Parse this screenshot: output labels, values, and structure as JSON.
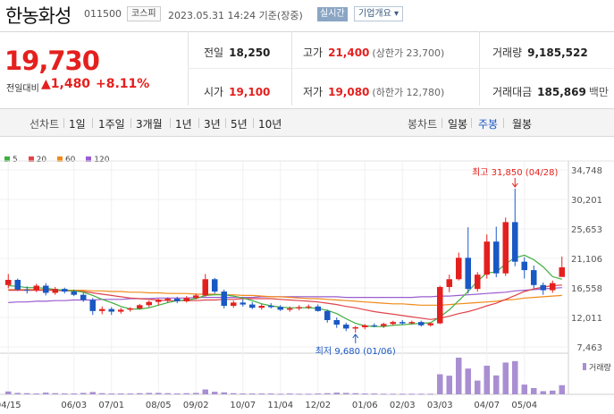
{
  "header": {
    "name": "한농화성",
    "code": "011500",
    "market": "코스피",
    "time": "2023.05.31 14:24 기준(장중)",
    "realtime": "실시간",
    "overview": "기업개요 ▾"
  },
  "quote": {
    "price": "19,730",
    "change_label": "전일대비",
    "change": "▲1,480",
    "change_pct": "+8.11%"
  },
  "stats": {
    "prev_label": "전일",
    "prev": "18,250",
    "high_label": "고가",
    "high": "21,400",
    "upper_limit": "(상한가 23,700)",
    "volume_label": "거래량",
    "volume": "9,185,522",
    "open_label": "시가",
    "open": "19,100",
    "low_label": "저가",
    "low": "19,080",
    "lower_limit": "(하한가 12,780)",
    "amount_label": "거래대금",
    "amount": "185,869",
    "amount_unit": "백만"
  },
  "period_bar": {
    "line_group": "선차트",
    "line_tabs": [
      "1일",
      "1주일",
      "3개월",
      "1년",
      "3년",
      "5년",
      "10년"
    ],
    "candle_group": "봉차트",
    "candle_tabs": [
      "일봉",
      "주봉",
      "월봉"
    ],
    "active_candle": "주봉"
  },
  "colors": {
    "up": "#e4201e",
    "down": "#1a58c4",
    "ma5": "#3fae3f",
    "ma20": "#e0434a",
    "ma60": "#f08a1a",
    "ma120": "#9a5cd0",
    "volume": "#a98fd2"
  },
  "chart_data": {
    "type": "candlestick",
    "interval": "weekly",
    "legend": [
      {
        "name": "5",
        "color": "#3fae3f"
      },
      {
        "name": "20",
        "color": "#e0434a"
      },
      {
        "name": "60",
        "color": "#f08a1a"
      },
      {
        "name": "120",
        "color": "#9a5cd0"
      }
    ],
    "ylim": [
      7463,
      34748
    ],
    "y_ticks": [
      "34,748",
      "30,201",
      "25,653",
      "21,106",
      "16,558",
      "12,011",
      "7,463"
    ],
    "y_tick_values": [
      34748,
      30201,
      25653,
      21106,
      16558,
      12011,
      7463
    ],
    "x_ticks": [
      "04/15",
      "06/03",
      "07/01",
      "08/05",
      "09/02",
      "10/07",
      "11/04",
      "12/02",
      "01/06",
      "02/03",
      "03/03",
      "04/07",
      "05/04"
    ],
    "x_tick_index": [
      0,
      7,
      11,
      16,
      20,
      25,
      29,
      33,
      38,
      42,
      46,
      51,
      55
    ],
    "candles": [
      {
        "o": 17000,
        "h": 18700,
        "l": 16500,
        "c": 17800
      },
      {
        "o": 17800,
        "h": 18000,
        "l": 16100,
        "c": 16300
      },
      {
        "o": 16300,
        "h": 16800,
        "l": 15700,
        "c": 16200
      },
      {
        "o": 16200,
        "h": 17200,
        "l": 15900,
        "c": 16900
      },
      {
        "o": 16900,
        "h": 17300,
        "l": 15400,
        "c": 15800
      },
      {
        "o": 15800,
        "h": 16700,
        "l": 15500,
        "c": 16400
      },
      {
        "o": 16400,
        "h": 16600,
        "l": 15700,
        "c": 16000
      },
      {
        "o": 16000,
        "h": 16300,
        "l": 15300,
        "c": 15500
      },
      {
        "o": 15500,
        "h": 15800,
        "l": 14400,
        "c": 14700
      },
      {
        "o": 14700,
        "h": 15000,
        "l": 12400,
        "c": 13000
      },
      {
        "o": 13000,
        "h": 13700,
        "l": 12500,
        "c": 13300
      },
      {
        "o": 13300,
        "h": 13600,
        "l": 12400,
        "c": 12900
      },
      {
        "o": 12900,
        "h": 13500,
        "l": 12600,
        "c": 13200
      },
      {
        "o": 13200,
        "h": 13600,
        "l": 12900,
        "c": 13400
      },
      {
        "o": 13400,
        "h": 14100,
        "l": 13200,
        "c": 13900
      },
      {
        "o": 13900,
        "h": 14600,
        "l": 13600,
        "c": 14400
      },
      {
        "o": 14400,
        "h": 14900,
        "l": 13900,
        "c": 14700
      },
      {
        "o": 14700,
        "h": 15100,
        "l": 14300,
        "c": 14900
      },
      {
        "o": 14900,
        "h": 15200,
        "l": 14200,
        "c": 14500
      },
      {
        "o": 14500,
        "h": 15300,
        "l": 14300,
        "c": 15000
      },
      {
        "o": 15000,
        "h": 15700,
        "l": 14800,
        "c": 15400
      },
      {
        "o": 15400,
        "h": 18700,
        "l": 15200,
        "c": 17900
      },
      {
        "o": 17900,
        "h": 18100,
        "l": 15700,
        "c": 16000
      },
      {
        "o": 16000,
        "h": 16300,
        "l": 13400,
        "c": 13800
      },
      {
        "o": 13800,
        "h": 14600,
        "l": 13500,
        "c": 14300
      },
      {
        "o": 14300,
        "h": 14800,
        "l": 13700,
        "c": 14000
      },
      {
        "o": 14000,
        "h": 14400,
        "l": 13300,
        "c": 13500
      },
      {
        "o": 13500,
        "h": 14100,
        "l": 13200,
        "c": 13800
      },
      {
        "o": 13800,
        "h": 14200,
        "l": 13400,
        "c": 13600
      },
      {
        "o": 13600,
        "h": 13900,
        "l": 13000,
        "c": 13200
      },
      {
        "o": 13200,
        "h": 13700,
        "l": 12900,
        "c": 13400
      },
      {
        "o": 13400,
        "h": 13900,
        "l": 13100,
        "c": 13600
      },
      {
        "o": 13600,
        "h": 14000,
        "l": 13300,
        "c": 13700
      },
      {
        "o": 13700,
        "h": 14000,
        "l": 12900,
        "c": 13000
      },
      {
        "o": 13000,
        "h": 13200,
        "l": 11200,
        "c": 11600
      },
      {
        "o": 11600,
        "h": 12000,
        "l": 10400,
        "c": 10900
      },
      {
        "o": 10900,
        "h": 11200,
        "l": 9900,
        "c": 10300
      },
      {
        "o": 10300,
        "h": 10700,
        "l": 9680,
        "c": 10500
      },
      {
        "o": 10500,
        "h": 11000,
        "l": 10200,
        "c": 10800
      },
      {
        "o": 10800,
        "h": 11100,
        "l": 10500,
        "c": 10700
      },
      {
        "o": 10700,
        "h": 11200,
        "l": 10400,
        "c": 11000
      },
      {
        "o": 11000,
        "h": 11500,
        "l": 10800,
        "c": 11300
      },
      {
        "o": 11300,
        "h": 11600,
        "l": 10900,
        "c": 11100
      },
      {
        "o": 11100,
        "h": 11500,
        "l": 10900,
        "c": 11300
      },
      {
        "o": 11300,
        "h": 11500,
        "l": 10600,
        "c": 10800
      },
      {
        "o": 10800,
        "h": 11200,
        "l": 10600,
        "c": 11100
      },
      {
        "o": 11100,
        "h": 16900,
        "l": 11000,
        "c": 16700
      },
      {
        "o": 16700,
        "h": 18600,
        "l": 15900,
        "c": 17900
      },
      {
        "o": 17900,
        "h": 22000,
        "l": 17700,
        "c": 21200
      },
      {
        "o": 21200,
        "h": 25900,
        "l": 15700,
        "c": 16400
      },
      {
        "o": 16400,
        "h": 19000,
        "l": 16000,
        "c": 18600
      },
      {
        "o": 18600,
        "h": 24800,
        "l": 18000,
        "c": 23700
      },
      {
        "o": 23700,
        "h": 26000,
        "l": 18200,
        "c": 18800
      },
      {
        "o": 18800,
        "h": 27400,
        "l": 18400,
        "c": 26700
      },
      {
        "o": 26700,
        "h": 31850,
        "l": 19900,
        "c": 20600
      },
      {
        "o": 20600,
        "h": 21300,
        "l": 18000,
        "c": 19300
      },
      {
        "o": 19300,
        "h": 20000,
        "l": 16500,
        "c": 17000
      },
      {
        "o": 17000,
        "h": 17400,
        "l": 15500,
        "c": 16200
      },
      {
        "o": 16200,
        "h": 17700,
        "l": 15800,
        "c": 17300
      },
      {
        "o": 18250,
        "h": 21400,
        "l": 19080,
        "c": 19730
      }
    ],
    "ma5": [
      16900,
      16800,
      16600,
      16600,
      16500,
      16300,
      16200,
      16100,
      15900,
      15400,
      14800,
      14300,
      13700,
      13300,
      13300,
      13500,
      13900,
      14300,
      14600,
      14700,
      14900,
      15400,
      15500,
      15500,
      15300,
      15000,
      14600,
      14100,
      13800,
      13600,
      13500,
      13500,
      13500,
      13400,
      13100,
      12600,
      11800,
      11100,
      10700,
      10600,
      10600,
      10800,
      10900,
      11000,
      11100,
      11200,
      12100,
      13200,
      14600,
      16000,
      17600,
      18900,
      19000,
      20300,
      21200,
      21600,
      20900,
      19800,
      18300,
      17900
    ],
    "ma20": [
      16200,
      16200,
      16200,
      16200,
      16200,
      16200,
      16100,
      16100,
      16000,
      15800,
      15600,
      15400,
      15200,
      15000,
      14900,
      14800,
      14700,
      14600,
      14600,
      14600,
      14600,
      14700,
      14700,
      14800,
      14800,
      14900,
      14900,
      14900,
      14900,
      14800,
      14700,
      14600,
      14500,
      14400,
      14200,
      14000,
      13700,
      13500,
      13200,
      12900,
      12700,
      12500,
      12300,
      12100,
      11900,
      11700,
      11900,
      12200,
      12600,
      12900,
      13300,
      13800,
      14200,
      14800,
      15400,
      16000,
      16400,
      16700,
      16900,
      17000
    ],
    "ma60": [
      16300,
      16300,
      16300,
      16300,
      16300,
      16300,
      16200,
      16200,
      16200,
      16100,
      16100,
      16000,
      16000,
      15900,
      15900,
      15800,
      15800,
      15700,
      15700,
      15700,
      15600,
      15600,
      15600,
      15500,
      15500,
      15400,
      15400,
      15300,
      15200,
      15200,
      15100,
      15000,
      14900,
      14900,
      14800,
      14700,
      14600,
      14500,
      14400,
      14300,
      14200,
      14100,
      14100,
      14000,
      13900,
      13900,
      13900,
      14000,
      14100,
      14200,
      14300,
      14400,
      14500,
      14700,
      14800,
      15000,
      15100,
      15200,
      15300,
      15400
    ],
    "ma120": [
      14300,
      14400,
      14400,
      14500,
      14500,
      14600,
      14600,
      14700,
      14700,
      14700,
      14800,
      14800,
      14800,
      14900,
      14900,
      14900,
      15000,
      15000,
      15000,
      15000,
      15100,
      15100,
      15100,
      15100,
      15100,
      15100,
      15100,
      15200,
      15200,
      15200,
      15200,
      15200,
      15200,
      15200,
      15200,
      15200,
      15100,
      15100,
      15100,
      15100,
      15100,
      15100,
      15100,
      15100,
      15200,
      15200,
      15300,
      15300,
      15400,
      15500,
      15600,
      15700,
      15800,
      15900,
      16100,
      16200,
      16300,
      16400,
      16500,
      16600
    ],
    "volume": [
      1.0,
      0.5,
      0.4,
      0.3,
      0.6,
      0.4,
      0.3,
      0.3,
      0.5,
      0.8,
      0.4,
      0.3,
      0.3,
      0.3,
      0.4,
      0.5,
      0.5,
      0.4,
      0.3,
      0.4,
      0.5,
      1.7,
      0.9,
      0.7,
      0.4,
      0.3,
      0.3,
      0.3,
      0.3,
      0.2,
      0.3,
      0.2,
      0.2,
      0.3,
      0.4,
      0.6,
      0.5,
      0.4,
      0.3,
      0.3,
      0.2,
      0.2,
      0.2,
      0.2,
      0.2,
      0.2,
      7.0,
      6.5,
      12.8,
      9.0,
      4.8,
      10.0,
      6.6,
      11.1,
      11.6,
      3.4,
      2.2,
      1.1,
      1.3,
      3.2
    ],
    "volume_label": "거래량",
    "high_annotation": {
      "label": "최고",
      "value": "31,850",
      "date": "(04/28)",
      "index": 54,
      "price": 31850
    },
    "low_annotation": {
      "label": "최저",
      "value": "9,680",
      "date": "(01/06)",
      "index": 37,
      "price": 9680
    }
  }
}
